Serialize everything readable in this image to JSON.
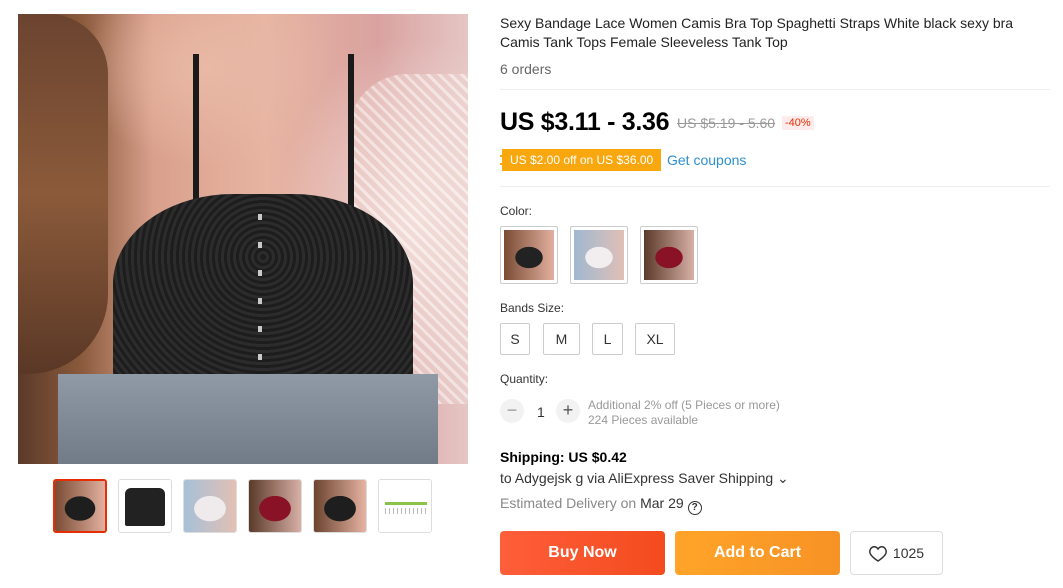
{
  "product": {
    "title": "Sexy Bandage Lace Women Camis Bra Top Spaghetti Straps White black sexy bra Camis Tank Tops Female Sleeveless Tank Top",
    "orders": "6 orders"
  },
  "price": {
    "current": "US $3.11 - 3.36",
    "original": "US $5.19 - 5.60",
    "discount": "-40%"
  },
  "coupon": {
    "badge": "US $2.00 off on US $36.00",
    "link": "Get coupons"
  },
  "color": {
    "label": "Color:",
    "options": [
      "black",
      "white",
      "red"
    ],
    "colors": {
      "black": "#2a2a2a",
      "white": "#e8e4e6",
      "red": "#7a1024"
    }
  },
  "size": {
    "label": "Bands Size:",
    "options": [
      "S",
      "M",
      "L",
      "XL"
    ]
  },
  "quantity": {
    "label": "Quantity:",
    "minus": "−",
    "value": "1",
    "plus": "+",
    "note": "Additional 2% off (5 Pieces or more)",
    "available": "224 Pieces available"
  },
  "shipping": {
    "title": "Shipping: US $0.42",
    "to": "to Adygejsk g via AliExpress Saver Shipping ⌄",
    "delivery_prefix": "Estimated Delivery on",
    "delivery_date": "Mar 29",
    "help": "?"
  },
  "actions": {
    "buy_now": "Buy Now",
    "add_to_cart": "Add to Cart",
    "wishlist_count": "1025"
  },
  "theme": {
    "accent_red": "#e62e04",
    "buy_gradient_start": "#ff5e3a",
    "cart_gradient_start": "#ffa428",
    "coupon_orange": "#f9a70f",
    "link_blue": "#2e8fd1"
  }
}
